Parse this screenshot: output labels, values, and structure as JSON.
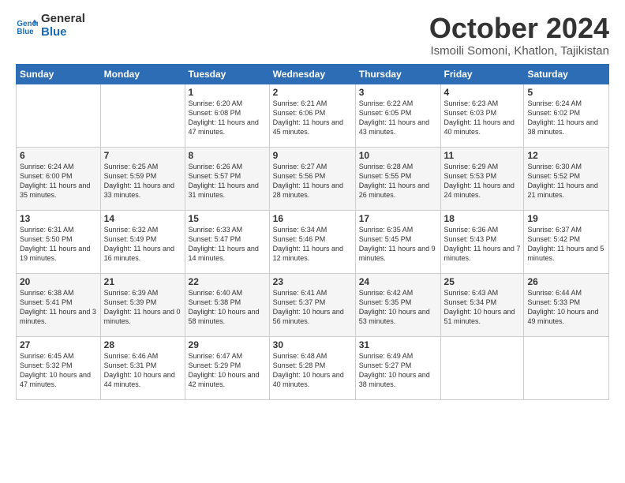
{
  "logo": {
    "line1": "General",
    "line2": "Blue"
  },
  "title": "October 2024",
  "location": "Ismoili Somoni, Khatlon, Tajikistan",
  "days_of_week": [
    "Sunday",
    "Monday",
    "Tuesday",
    "Wednesday",
    "Thursday",
    "Friday",
    "Saturday"
  ],
  "weeks": [
    [
      {
        "day": "",
        "info": ""
      },
      {
        "day": "",
        "info": ""
      },
      {
        "day": "1",
        "info": "Sunrise: 6:20 AM\nSunset: 6:08 PM\nDaylight: 11 hours and 47 minutes."
      },
      {
        "day": "2",
        "info": "Sunrise: 6:21 AM\nSunset: 6:06 PM\nDaylight: 11 hours and 45 minutes."
      },
      {
        "day": "3",
        "info": "Sunrise: 6:22 AM\nSunset: 6:05 PM\nDaylight: 11 hours and 43 minutes."
      },
      {
        "day": "4",
        "info": "Sunrise: 6:23 AM\nSunset: 6:03 PM\nDaylight: 11 hours and 40 minutes."
      },
      {
        "day": "5",
        "info": "Sunrise: 6:24 AM\nSunset: 6:02 PM\nDaylight: 11 hours and 38 minutes."
      }
    ],
    [
      {
        "day": "6",
        "info": "Sunrise: 6:24 AM\nSunset: 6:00 PM\nDaylight: 11 hours and 35 minutes."
      },
      {
        "day": "7",
        "info": "Sunrise: 6:25 AM\nSunset: 5:59 PM\nDaylight: 11 hours and 33 minutes."
      },
      {
        "day": "8",
        "info": "Sunrise: 6:26 AM\nSunset: 5:57 PM\nDaylight: 11 hours and 31 minutes."
      },
      {
        "day": "9",
        "info": "Sunrise: 6:27 AM\nSunset: 5:56 PM\nDaylight: 11 hours and 28 minutes."
      },
      {
        "day": "10",
        "info": "Sunrise: 6:28 AM\nSunset: 5:55 PM\nDaylight: 11 hours and 26 minutes."
      },
      {
        "day": "11",
        "info": "Sunrise: 6:29 AM\nSunset: 5:53 PM\nDaylight: 11 hours and 24 minutes."
      },
      {
        "day": "12",
        "info": "Sunrise: 6:30 AM\nSunset: 5:52 PM\nDaylight: 11 hours and 21 minutes."
      }
    ],
    [
      {
        "day": "13",
        "info": "Sunrise: 6:31 AM\nSunset: 5:50 PM\nDaylight: 11 hours and 19 minutes."
      },
      {
        "day": "14",
        "info": "Sunrise: 6:32 AM\nSunset: 5:49 PM\nDaylight: 11 hours and 16 minutes."
      },
      {
        "day": "15",
        "info": "Sunrise: 6:33 AM\nSunset: 5:47 PM\nDaylight: 11 hours and 14 minutes."
      },
      {
        "day": "16",
        "info": "Sunrise: 6:34 AM\nSunset: 5:46 PM\nDaylight: 11 hours and 12 minutes."
      },
      {
        "day": "17",
        "info": "Sunrise: 6:35 AM\nSunset: 5:45 PM\nDaylight: 11 hours and 9 minutes."
      },
      {
        "day": "18",
        "info": "Sunrise: 6:36 AM\nSunset: 5:43 PM\nDaylight: 11 hours and 7 minutes."
      },
      {
        "day": "19",
        "info": "Sunrise: 6:37 AM\nSunset: 5:42 PM\nDaylight: 11 hours and 5 minutes."
      }
    ],
    [
      {
        "day": "20",
        "info": "Sunrise: 6:38 AM\nSunset: 5:41 PM\nDaylight: 11 hours and 3 minutes."
      },
      {
        "day": "21",
        "info": "Sunrise: 6:39 AM\nSunset: 5:39 PM\nDaylight: 11 hours and 0 minutes."
      },
      {
        "day": "22",
        "info": "Sunrise: 6:40 AM\nSunset: 5:38 PM\nDaylight: 10 hours and 58 minutes."
      },
      {
        "day": "23",
        "info": "Sunrise: 6:41 AM\nSunset: 5:37 PM\nDaylight: 10 hours and 56 minutes."
      },
      {
        "day": "24",
        "info": "Sunrise: 6:42 AM\nSunset: 5:35 PM\nDaylight: 10 hours and 53 minutes."
      },
      {
        "day": "25",
        "info": "Sunrise: 6:43 AM\nSunset: 5:34 PM\nDaylight: 10 hours and 51 minutes."
      },
      {
        "day": "26",
        "info": "Sunrise: 6:44 AM\nSunset: 5:33 PM\nDaylight: 10 hours and 49 minutes."
      }
    ],
    [
      {
        "day": "27",
        "info": "Sunrise: 6:45 AM\nSunset: 5:32 PM\nDaylight: 10 hours and 47 minutes."
      },
      {
        "day": "28",
        "info": "Sunrise: 6:46 AM\nSunset: 5:31 PM\nDaylight: 10 hours and 44 minutes."
      },
      {
        "day": "29",
        "info": "Sunrise: 6:47 AM\nSunset: 5:29 PM\nDaylight: 10 hours and 42 minutes."
      },
      {
        "day": "30",
        "info": "Sunrise: 6:48 AM\nSunset: 5:28 PM\nDaylight: 10 hours and 40 minutes."
      },
      {
        "day": "31",
        "info": "Sunrise: 6:49 AM\nSunset: 5:27 PM\nDaylight: 10 hours and 38 minutes."
      },
      {
        "day": "",
        "info": ""
      },
      {
        "day": "",
        "info": ""
      }
    ]
  ]
}
